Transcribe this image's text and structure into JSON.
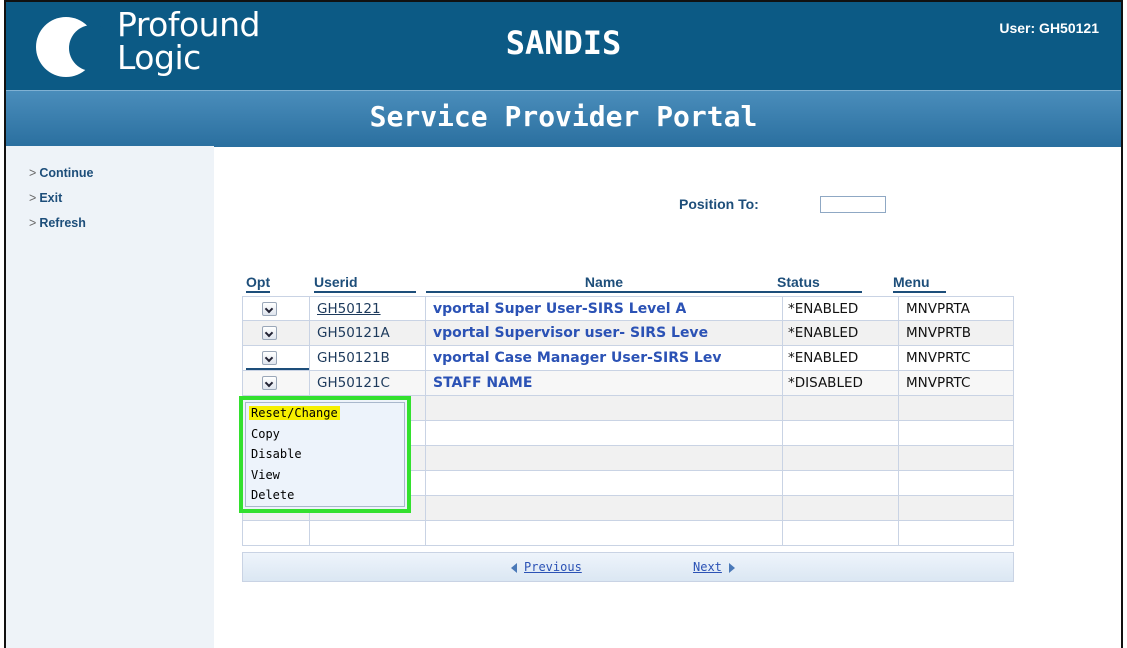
{
  "header": {
    "logo_line1": "Profound",
    "logo_line2": "Logic",
    "app_title": "SANDIS",
    "user": "User: GH50121",
    "subtitle": "Service Provider Portal",
    "colors": {
      "header_bg": "#0c5a85",
      "subheader_bg": "#2a6f9f"
    }
  },
  "sidebar": {
    "items": [
      {
        "label": "Continue"
      },
      {
        "label": "Exit"
      },
      {
        "label": "Refresh"
      }
    ]
  },
  "position_to": {
    "label": "Position To:",
    "value": ""
  },
  "grid": {
    "headers": {
      "opt": "Opt",
      "userid": "Userid",
      "name": "Name",
      "status": "Status",
      "menu": "Menu"
    },
    "rows": [
      {
        "userid": "GH50121",
        "name": "vportal Super User-SIRS Level A",
        "status": "*ENABLED",
        "menu": "MNVPRTA"
      },
      {
        "userid": "GH50121A",
        "name": "vportal Supervisor user- SIRS Leve",
        "status": "*ENABLED",
        "menu": "MNVPRTB"
      },
      {
        "userid": "GH50121B",
        "name": "vportal Case Manager User-SIRS Lev",
        "status": "*ENABLED",
        "menu": "MNVPRTC"
      },
      {
        "userid": "GH50121C",
        "name": "STAFF NAME",
        "status": "*DISABLED",
        "menu": "MNVPRTC"
      }
    ]
  },
  "pager": {
    "previous": "Previous",
    "next": "Next"
  },
  "option_menu": {
    "items": [
      {
        "label": "Reset/Change",
        "highlighted": true
      },
      {
        "label": "Copy"
      },
      {
        "label": "Disable"
      },
      {
        "label": "View"
      },
      {
        "label": "Delete"
      }
    ],
    "highlight_color": "#f6f000",
    "frame_color": "#33e02e"
  }
}
